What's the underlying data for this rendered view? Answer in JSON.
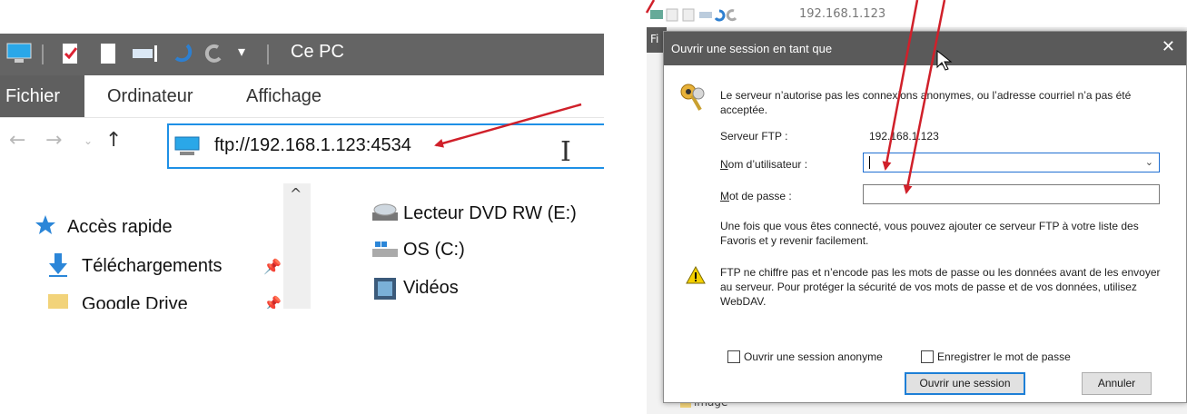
{
  "explorer": {
    "window_title": "Ce PC",
    "ribbon_tabs": [
      "Fichier",
      "Ordinateur",
      "Affichage"
    ],
    "address": "ftp://192.168.1.123:4534",
    "quick_access": "Accès rapide",
    "nav_items": [
      "Téléchargements",
      "Google Drive"
    ],
    "drives": [
      "Lecteur DVD RW (E:)",
      "OS (C:)",
      "Vidéos"
    ]
  },
  "bg_window": {
    "qat_text": "192.168.1.123",
    "file_tab_partial": "Fi",
    "folder_partial": "image"
  },
  "dialog": {
    "title": "Ouvrir une session en tant que",
    "message": "Le serveur n’autorise pas les connexions anonymes, ou l’adresse courriel n’a pas été acceptée.",
    "server_label": "Serveur FTP :",
    "server_value": "192.168.1.123",
    "user_label": "Nom d’utilisateur :",
    "user_value": "",
    "password_label": "Mot de passe :",
    "password_value": "",
    "info": "Une fois que vous êtes connecté, vous pouvez ajouter ce serveur FTP à votre liste des Favoris et y revenir facilement.",
    "warning": "FTP ne chiffre pas et n’encode pas les mots de passe ou les données avant de les envoyer au serveur. Pour protéger la sécurité de vos mots de passe et de vos données, utilisez WebDAV.",
    "anon_checkbox": "Ouvrir une session anonyme",
    "save_checkbox": "Enregistrer le mot de passe",
    "ok_button": "Ouvrir une session",
    "cancel_button": "Annuler"
  },
  "colors": {
    "annotation_arrow": "#d0202a",
    "title_bar": "#5a5a5a",
    "address_border": "#1e90e6"
  }
}
